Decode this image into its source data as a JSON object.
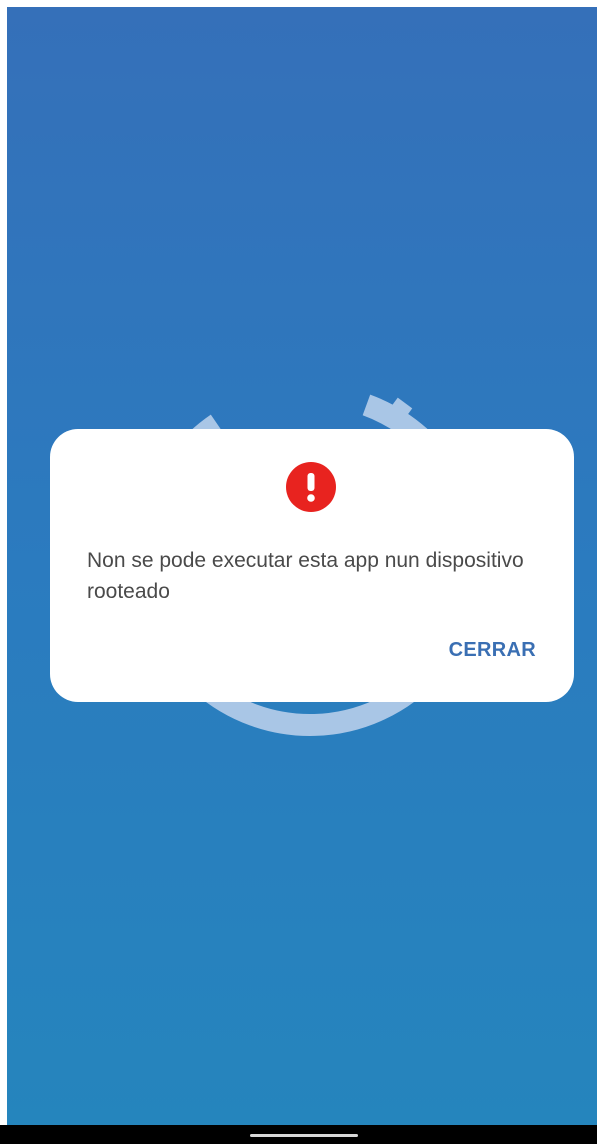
{
  "dialog": {
    "icon": "exclamation-alert-icon",
    "message": "Non se pode executar esta app nun dispositivo rooteado",
    "close_label": "CERRAR"
  },
  "colors": {
    "background_top": "#3570b9",
    "background_bottom": "#2585bd",
    "alert_red": "#e8231f",
    "button_text": "#3a6fb3",
    "message_text": "#4a4a4a",
    "logo_ring": "#a9c6e6"
  },
  "splash": {
    "logo_icon": "power-ring-logo-icon"
  },
  "system": {
    "nav_indicator_icon": "home-indicator-icon"
  }
}
